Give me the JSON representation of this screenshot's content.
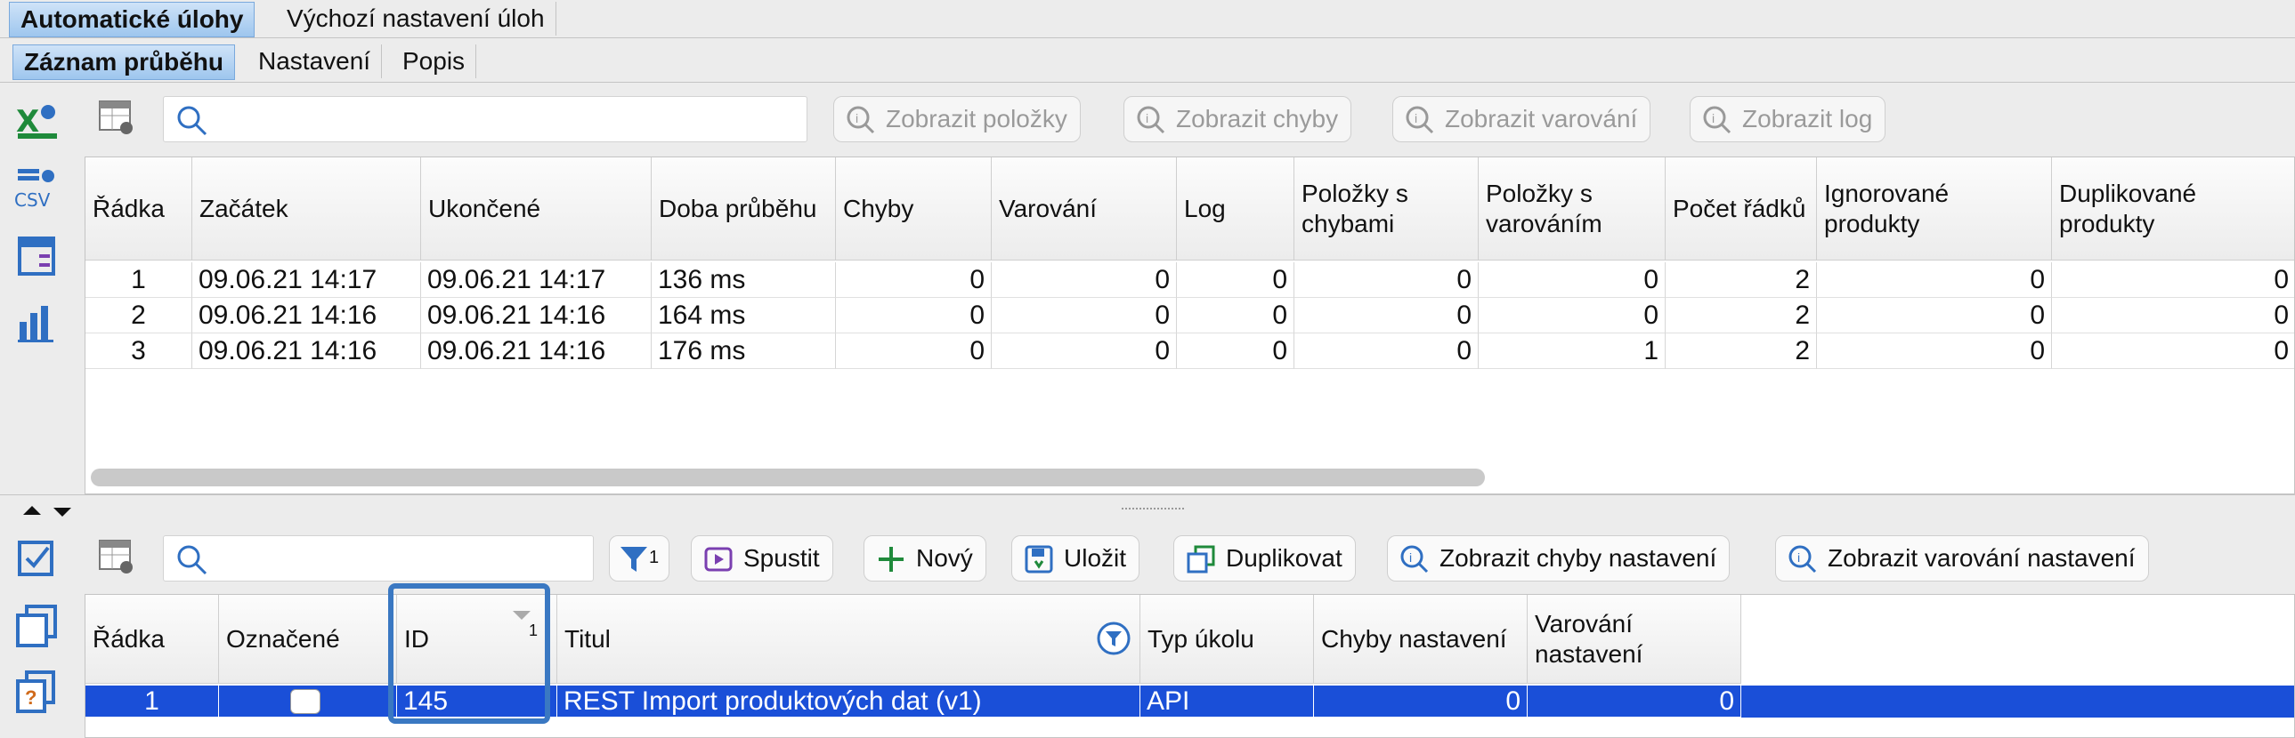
{
  "top_tabs": [
    "Automatické úlohy",
    "Výchozí nastavení úloh"
  ],
  "sub_tabs": [
    "Záznam průběhu",
    "Nastavení",
    "Popis"
  ],
  "upper": {
    "search_value": "",
    "buttons": [
      "Zobrazit položky",
      "Zobrazit chyby",
      "Zobrazit varování",
      "Zobrazit log"
    ],
    "columns": [
      "Řádka",
      "Začátek",
      "Ukončené",
      "Doba průběhu",
      "Chyby",
      "Varování",
      "Log",
      "Položky s chybami",
      "Položky s varováním",
      "Počet řádků",
      "Ignorované produkty",
      "Duplikované produkty"
    ],
    "rows": [
      [
        "1",
        "09.06.21 14:17",
        "09.06.21 14:17",
        "136 ms",
        "0",
        "0",
        "0",
        "0",
        "0",
        "2",
        "0",
        "0"
      ],
      [
        "2",
        "09.06.21 14:16",
        "09.06.21 14:16",
        "164 ms",
        "0",
        "0",
        "0",
        "0",
        "0",
        "2",
        "0",
        "0"
      ],
      [
        "3",
        "09.06.21 14:16",
        "09.06.21 14:16",
        "176 ms",
        "0",
        "0",
        "0",
        "0",
        "1",
        "2",
        "0",
        "0"
      ]
    ]
  },
  "lower": {
    "search_value": "",
    "filter_count": "1",
    "buttons": [
      "Spustit",
      "Nový",
      "Uložit",
      "Duplikovat",
      "Zobrazit chyby nastavení",
      "Zobrazit varování nastavení"
    ],
    "columns": [
      "Řádka",
      "Označené",
      "ID",
      "Titul",
      "Typ úkolu",
      "Chyby nastavení",
      "Varování nastavení"
    ],
    "sort_index": "1",
    "rows": [
      [
        "1",
        "",
        "145",
        "REST Import produktových dat (v1)",
        "API",
        "0",
        "0"
      ]
    ]
  },
  "colors": {
    "selection": "#1a4fd8",
    "highlight": "#3a78c2",
    "active_tab": "#9ec6ee"
  }
}
